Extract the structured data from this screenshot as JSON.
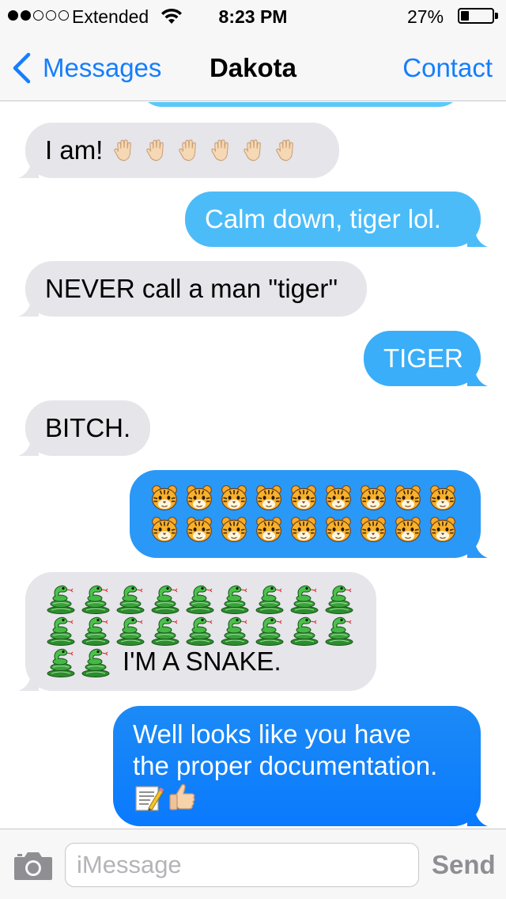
{
  "status_bar": {
    "carrier": "Extended",
    "time": "8:23 PM",
    "battery_percent": "27%",
    "battery_level": 0.27,
    "signal_bars_filled": 2,
    "signal_bars_total": 5
  },
  "nav": {
    "back_label": "Messages",
    "title": "Dakota",
    "contact_label": "Contact"
  },
  "messages": [
    {
      "direction": "incoming",
      "text": "I am!",
      "emoji": [
        "raised-hand",
        "raised-hand",
        "raised-hand",
        "raised-hand",
        "raised-hand",
        "raised-hand"
      ]
    },
    {
      "direction": "outgoing",
      "text": "Calm down, tiger lol."
    },
    {
      "direction": "incoming",
      "text": "NEVER call a man \"tiger\""
    },
    {
      "direction": "outgoing",
      "text": "TIGER"
    },
    {
      "direction": "incoming",
      "text": "BITCH."
    },
    {
      "direction": "outgoing",
      "emoji_rows": [
        9,
        9
      ],
      "emoji": "tiger-face"
    },
    {
      "direction": "incoming",
      "emoji_rows": [
        9,
        9,
        2
      ],
      "emoji": "snake",
      "text": "I'M A SNAKE."
    },
    {
      "direction": "outgoing",
      "lines": [
        "Well looks like you have",
        "the proper documentation."
      ],
      "emoji": [
        "memo",
        "thumbs-up"
      ]
    }
  ],
  "composer": {
    "placeholder": "iMessage",
    "send_label": "Send"
  },
  "colors": {
    "ios_blue": "#157efb",
    "incoming_bubble": "#e5e5ea",
    "outgoing_top": "#5ac8fa",
    "outgoing_bottom": "#0a7afe"
  }
}
